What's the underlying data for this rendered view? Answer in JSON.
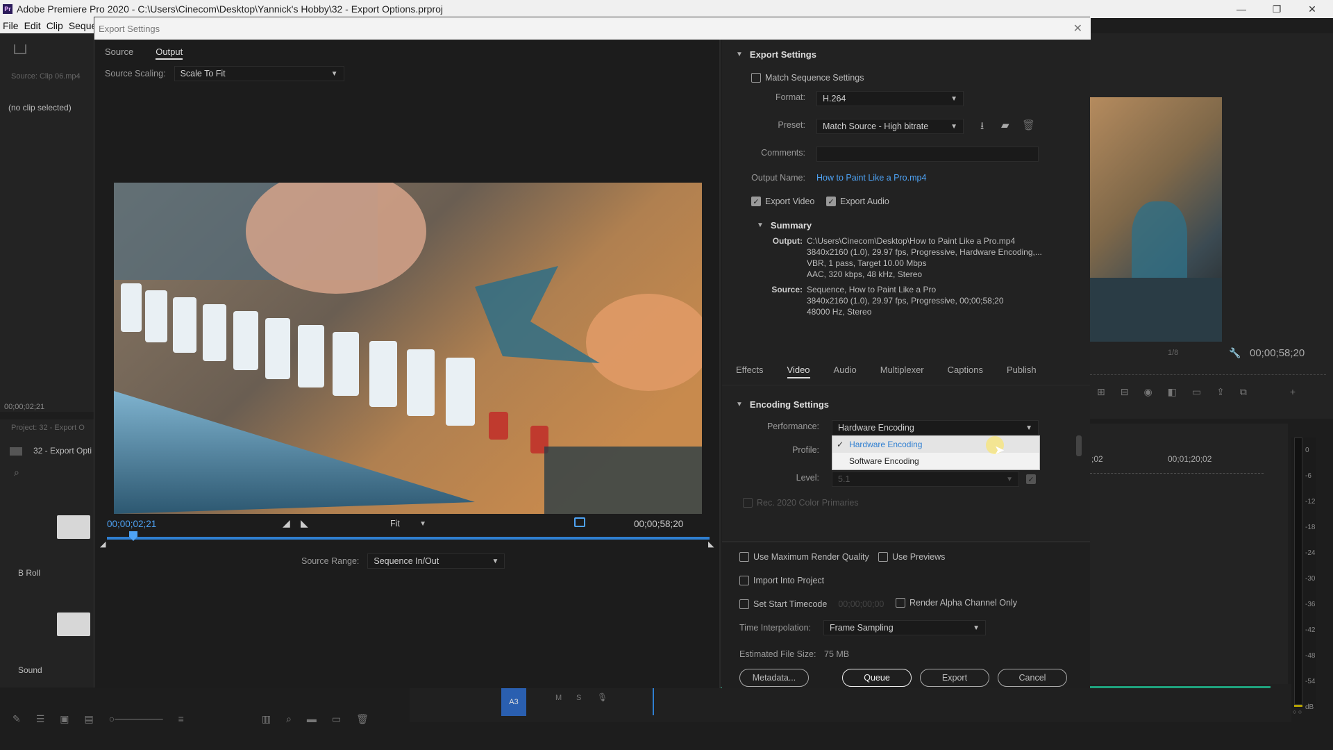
{
  "window": {
    "title": "Adobe Premiere Pro 2020 - C:\\Users\\Cinecom\\Desktop\\Yannick's Hobby\\32 - Export Options.prproj",
    "logo": "Pr",
    "controls": {
      "minimize": "—",
      "maximize": "❐",
      "close": "✕"
    }
  },
  "menu": [
    "File",
    "Edit",
    "Clip",
    "Sequen"
  ],
  "background": {
    "source_label": "Source: Clip 06.mp4",
    "no_clip": "(no clip selected)",
    "timecode_left": "00;00;02;21",
    "project_label": "Project: 32 - Export O",
    "project_item": "32 - Export Opti",
    "bin1": "B Roll",
    "bin2": "Sound",
    "right_timecode": "00;00;58;20",
    "right_fraction": "1/8",
    "timeline_marks": [
      ";02",
      "00;01;20;02"
    ],
    "meter_labels": [
      "0",
      "-6",
      "-12",
      "-18",
      "-24",
      "-30",
      "-36",
      "-42",
      "-48",
      "-54",
      "dB"
    ],
    "track_label": "A3",
    "track_letters": [
      "M",
      "S"
    ],
    "meter_footer": "○ ○"
  },
  "dialog": {
    "title": "Export Settings",
    "close": "✕",
    "tabs": [
      {
        "label": "Source"
      },
      {
        "label": "Output",
        "active": true
      }
    ],
    "source_scaling_label": "Source Scaling:",
    "source_scaling_value": "Scale To Fit",
    "timecode_current": "00;00;02;21",
    "timecode_end": "00;00;58;20",
    "fit_value": "Fit",
    "source_range_label": "Source Range:",
    "source_range_value": "Sequence In/Out",
    "export_settings": {
      "heading": "Export Settings",
      "match_sequence": "Match Sequence Settings",
      "format_label": "Format:",
      "format_value": "H.264",
      "preset_label": "Preset:",
      "preset_value": "Match Source - High bitrate",
      "comments_label": "Comments:",
      "output_name_label": "Output Name:",
      "output_name_value": "How to Paint Like a Pro.mp4",
      "export_video": "Export Video",
      "export_audio": "Export Audio",
      "summary_heading": "Summary",
      "output_key": "Output:",
      "output_lines": [
        "C:\\Users\\Cinecom\\Desktop\\How to Paint Like a Pro.mp4",
        "3840x2160 (1.0), 29.97 fps, Progressive, Hardware Encoding,...",
        "VBR, 1 pass, Target 10.00 Mbps",
        "AAC, 320 kbps, 48 kHz, Stereo"
      ],
      "source_key": "Source:",
      "source_lines": [
        "Sequence, How to Paint Like a Pro",
        "3840x2160 (1.0), 29.97 fps, Progressive, 00;00;58;20",
        "48000 Hz, Stereo"
      ]
    },
    "settings_tabs": [
      {
        "label": "Effects"
      },
      {
        "label": "Video",
        "active": true
      },
      {
        "label": "Audio"
      },
      {
        "label": "Multiplexer"
      },
      {
        "label": "Captions"
      },
      {
        "label": "Publish"
      }
    ],
    "encoding": {
      "heading": "Encoding Settings",
      "performance_label": "Performance:",
      "performance_value": "Hardware Encoding",
      "options": [
        "Hardware Encoding",
        "Software Encoding"
      ],
      "selected_option": "Hardware Encoding",
      "profile_label": "Profile:",
      "level_label": "Level:",
      "level_value": "5.1",
      "rec2020": "Rec. 2020 Color Primaries"
    },
    "bottom": {
      "max_render": "Use Maximum Render Quality",
      "use_previews": "Use Previews",
      "import_project": "Import Into Project",
      "set_start_tc": "Set Start Timecode",
      "start_tc_value": "00;00;00;00",
      "render_alpha": "Render Alpha Channel Only",
      "time_interp_label": "Time Interpolation:",
      "time_interp_value": "Frame Sampling",
      "est_size_label": "Estimated File Size:",
      "est_size_value": "75 MB",
      "metadata_btn": "Metadata...",
      "queue_btn": "Queue",
      "export_btn": "Export",
      "cancel_btn": "Cancel"
    }
  },
  "colors": {
    "accent": "#4ea3f5",
    "scrubber": "#2f7fd1",
    "progress": "#1fa37e"
  }
}
